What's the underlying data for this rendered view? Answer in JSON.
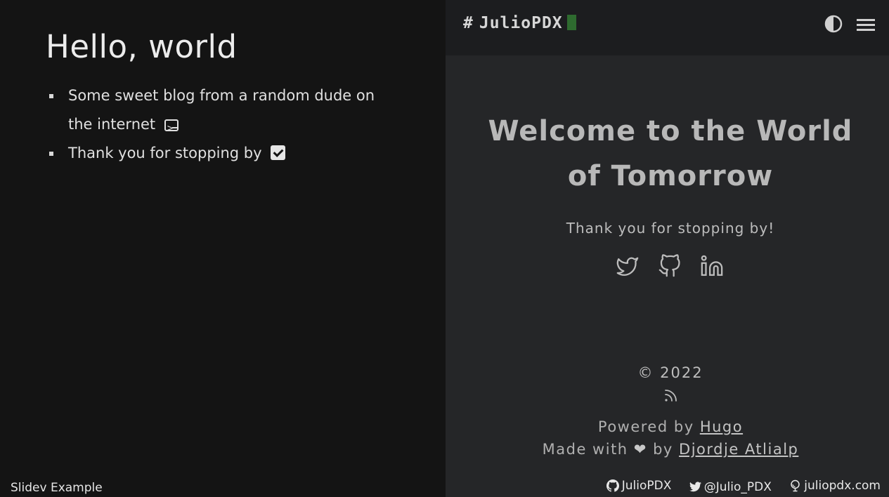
{
  "slide": {
    "title": "Hello, world",
    "bullets": [
      {
        "text": "Some sweet blog from a random dude on the internet",
        "icon": "terminal-icon"
      },
      {
        "text": "Thank you for stopping by",
        "icon": "check-box-icon"
      }
    ],
    "footer": "Slidev Example"
  },
  "site": {
    "logo_hash": "#",
    "logo_name": "JulioPDX",
    "welcome": "Welcome to the World of Tomorrow",
    "tagline": "Thank you for stopping by!",
    "social_icons": [
      "twitter-icon",
      "github-icon",
      "linkedin-icon"
    ],
    "copyright": "© 2022",
    "powered_prefix": "Powered by",
    "powered_link": "Hugo",
    "made_prefix": "Made with",
    "made_by": "by",
    "made_link": "Djordje Atlialp"
  },
  "footer_links": [
    {
      "icon": "github-icon",
      "label": "JulioPDX"
    },
    {
      "icon": "twitter-icon",
      "label": "@Julio_PDX"
    },
    {
      "icon": "globe-icon",
      "label": "juliopdx.com"
    }
  ],
  "colors": {
    "slide_bg": "#141414",
    "site_bg": "#252628",
    "header_bg": "#1c1d1f",
    "cursor_green": "#2e6b2f"
  }
}
